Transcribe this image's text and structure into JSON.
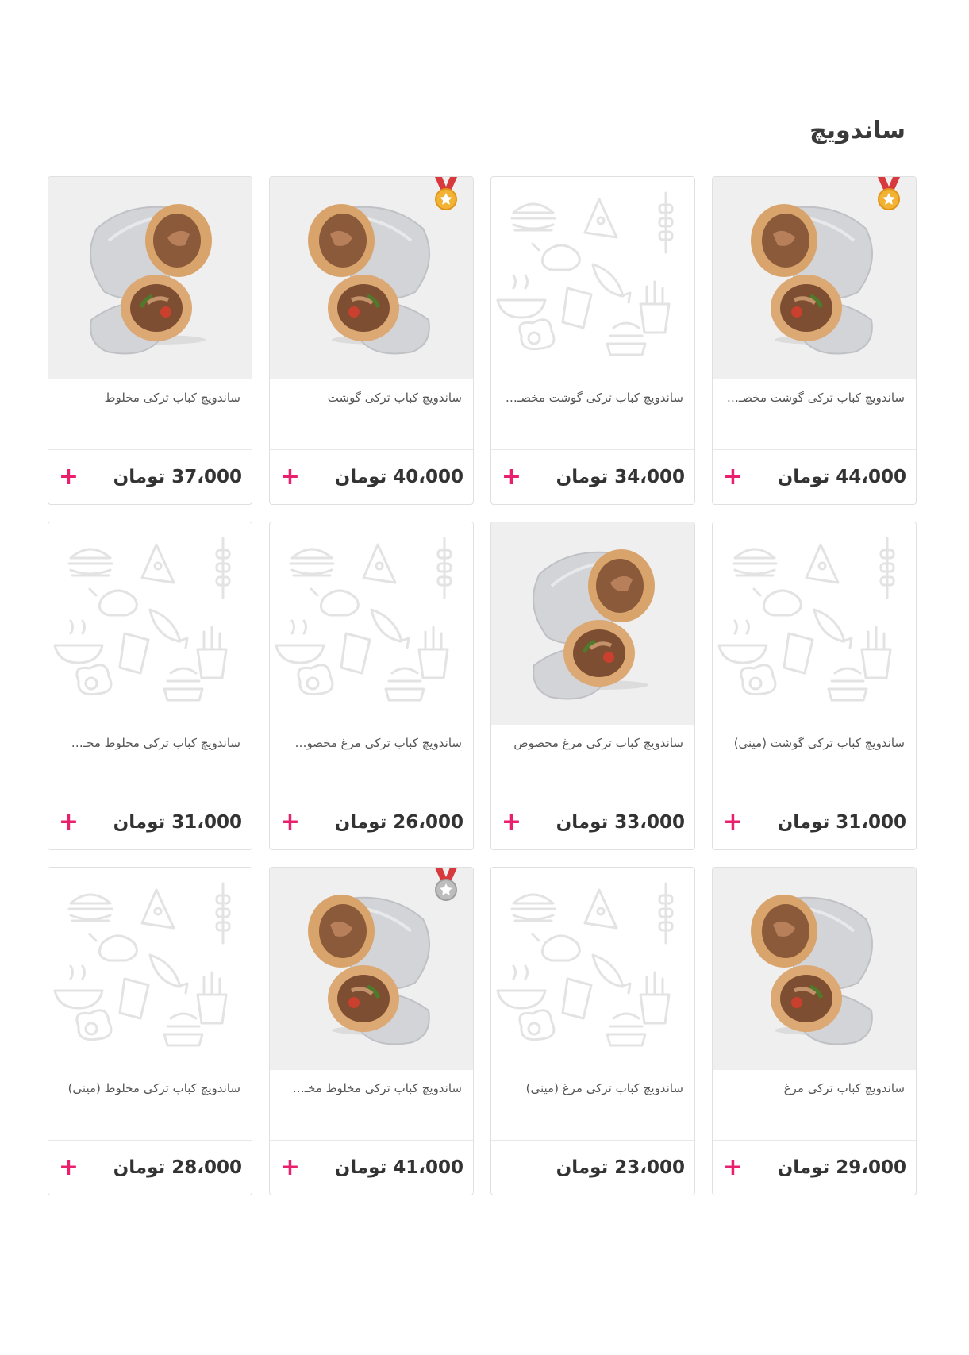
{
  "section": {
    "title": "ساندویچ"
  },
  "colors": {
    "accent": "#e8206e",
    "card_border": "#e0e0e0",
    "photo_bg": "#efefef"
  },
  "products": [
    {
      "name": "ساندویچ کباب ترکی گوشت مخصـ…",
      "price": "44،000 تومان",
      "image": "sandwich-photo",
      "medal": "gold",
      "add": "+"
    },
    {
      "name": "ساندویچ کباب ترکی گوشت مخصـ…",
      "price": "34،000 تومان",
      "image": "placeholder-pattern",
      "medal": "",
      "add": "+"
    },
    {
      "name": "ساندویچ کباب ترکی گوشت",
      "price": "40،000 تومان",
      "image": "sandwich-photo",
      "medal": "gold",
      "add": "+"
    },
    {
      "name": "ساندویچ کباب ترکی مخلوط",
      "price": "37،000 تومان",
      "image": "sandwich-photo",
      "medal": "",
      "add": "+"
    },
    {
      "name": "ساندویچ کباب ترکی گوشت (مینی)",
      "price": "31،000 تومان",
      "image": "placeholder-pattern",
      "medal": "",
      "add": "+"
    },
    {
      "name": "ساندویچ کباب ترکی مرغ مخصوص",
      "price": "33،000 تومان",
      "image": "sandwich-photo",
      "medal": "",
      "add": "+"
    },
    {
      "name": "ساندویچ کباب ترکی مرغ مخصو…",
      "price": "26،000 تومان",
      "image": "placeholder-pattern",
      "medal": "",
      "add": "+"
    },
    {
      "name": "ساندویچ کباب ترکی مخلوط مخـ…",
      "price": "31،000 تومان",
      "image": "placeholder-pattern",
      "medal": "",
      "add": "+"
    },
    {
      "name": "ساندویچ کباب ترکی مرغ",
      "price": "29،000 تومان",
      "image": "sandwich-photo",
      "medal": "",
      "add": "+"
    },
    {
      "name": "ساندویچ کباب ترکی مرغ (مینی)",
      "price": "23،000 تومان",
      "image": "placeholder-pattern",
      "medal": "",
      "add": ""
    },
    {
      "name": "ساندویچ کباب ترکی مخلوط مخـ…",
      "price": "41،000 تومان",
      "image": "sandwich-photo",
      "medal": "silver",
      "add": "+"
    },
    {
      "name": "ساندویچ کباب ترکی مخلوط (مینی)",
      "price": "28،000 تومان",
      "image": "placeholder-pattern",
      "medal": "",
      "add": "+"
    }
  ]
}
